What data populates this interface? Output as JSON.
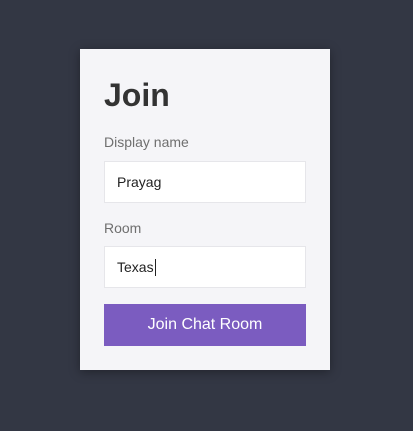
{
  "form": {
    "title": "Join",
    "display_name_label": "Display name",
    "display_name_value": "Prayag",
    "room_label": "Room",
    "room_value": "Texas",
    "submit_label": "Join Chat Room"
  },
  "colors": {
    "background": "#333744",
    "card": "#f5f5f8",
    "button": "#7b5cc0"
  }
}
